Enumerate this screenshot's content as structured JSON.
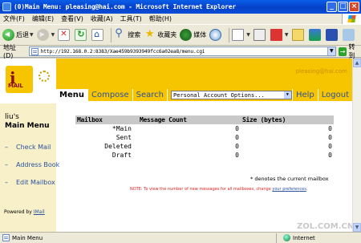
{
  "window": {
    "title": "(0)Main Menu: pleasing@hai.com - Microsoft Internet Explorer",
    "controls": [
      "_",
      "□",
      "×"
    ]
  },
  "menubar": {
    "items": [
      "文件(F)",
      "编辑(E)",
      "查看(V)",
      "收藏(A)",
      "工具(T)",
      "帮助(H)"
    ]
  },
  "toolbar": {
    "back_label": "后退",
    "search_label": "搜索",
    "favorites_label": "收藏夹",
    "media_label": "媒体"
  },
  "addressbar": {
    "label": "地址(D)",
    "url": "http://192.168.0.2:8383/Xae459b9393949fcc6a02ea8/menu.cgi",
    "go_label": "转到"
  },
  "header": {
    "brand_text": "pleasing@hai.com",
    "logo_letter": "i",
    "logo_text": "MAIL"
  },
  "nav": {
    "tabs": [
      "Menu",
      "Compose",
      "Search"
    ],
    "account_select": "Personal Account Options...",
    "help": "Help",
    "logout": "Logout"
  },
  "sidebar": {
    "user": "liu's",
    "title": "Main Menu",
    "links": [
      "Check Mail",
      "Address Book",
      "Edit Mailbox"
    ],
    "powered_by": "Powered by",
    "powered_link": "IMail"
  },
  "mailboxes": {
    "headers": [
      "Mailbox",
      "Message Count",
      "Size (bytes)"
    ],
    "rows": [
      {
        "name": "*Main",
        "count": "0",
        "size": "0"
      },
      {
        "name": "Sent",
        "count": "0",
        "size": "0"
      },
      {
        "name": "Deleted",
        "count": "0",
        "size": "0"
      },
      {
        "name": "Draft",
        "count": "0",
        "size": "0"
      }
    ],
    "denotes": "* denotes the current mailbox",
    "note_prefix": "NOTE: To view the number of new messages for all mailboxes, change ",
    "note_link": "your preferences",
    "note_suffix": "."
  },
  "watermark": "ZOL.COM.CN",
  "statusbar": {
    "text": "Main Menu",
    "zone": "Internet"
  },
  "colors": {
    "brand_yellow": "#f7c400",
    "sidebar_bg": "#f7f0c8",
    "link_blue": "#2a52a0",
    "table_header": "#c8c8c8",
    "note_red": "#dd2222"
  }
}
